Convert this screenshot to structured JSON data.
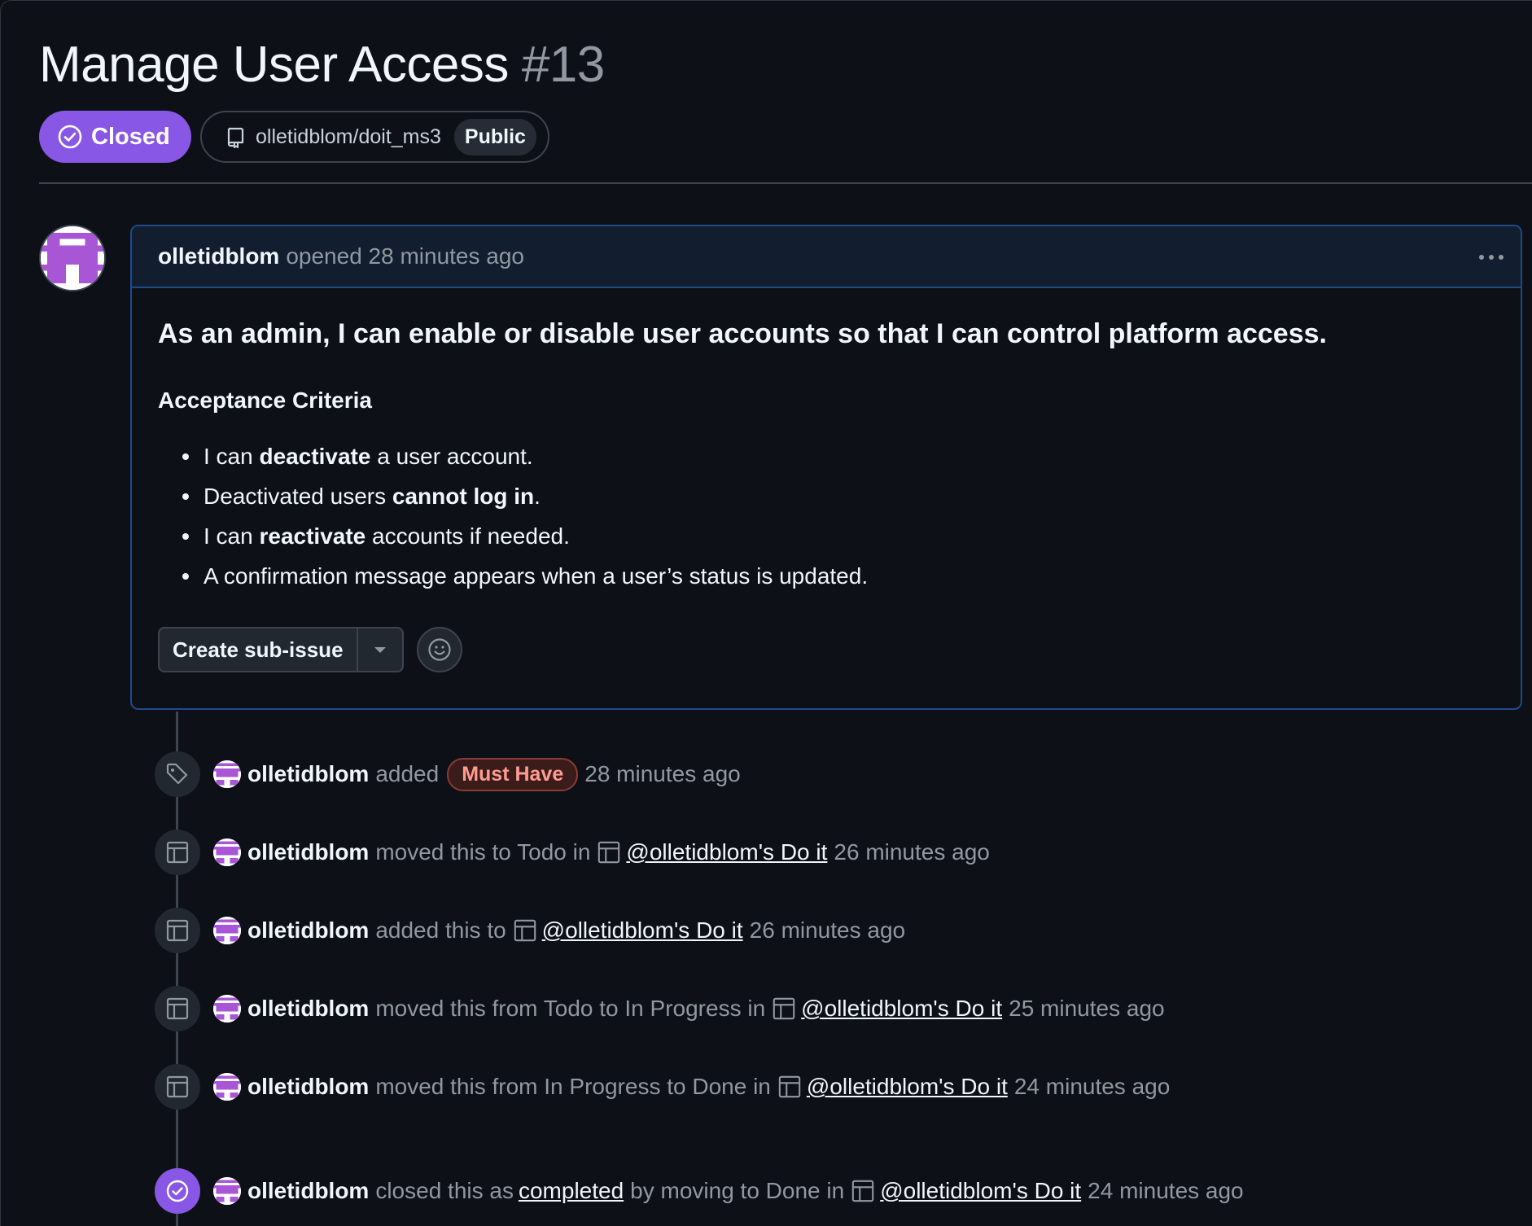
{
  "header": {
    "title": "Manage User Access",
    "number": "#13",
    "state_label": "Closed",
    "repo": "olletidblom/doit_ms3",
    "visibility": "Public"
  },
  "comment": {
    "author": "olletidblom",
    "meta": "opened 28 minutes ago",
    "lead": "As an admin, I can enable or disable user accounts so that I can control platform access.",
    "ac_heading": "Acceptance Criteria",
    "criteria": [
      {
        "pre": "I can ",
        "bold": "deactivate",
        "post": " a user account."
      },
      {
        "pre": "Deactivated users ",
        "bold": "cannot log in",
        "post": "."
      },
      {
        "pre": "I can ",
        "bold": "reactivate",
        "post": " accounts if needed."
      },
      {
        "pre": "A confirmation message appears when a user’s status is updated.",
        "bold": "",
        "post": ""
      }
    ],
    "create_sub_issue_label": "Create sub-issue"
  },
  "timeline": [
    {
      "icon": "tag-icon",
      "actor": "olletidblom",
      "text": "added",
      "label": "Must Have",
      "time": "28 minutes ago"
    },
    {
      "icon": "table-icon",
      "actor": "olletidblom",
      "text": "moved this to Todo in",
      "project": "@olletidblom's Do it",
      "time": "26 minutes ago"
    },
    {
      "icon": "table-icon",
      "actor": "olletidblom",
      "text": "added this to",
      "project": "@olletidblom's Do it",
      "time": "26 minutes ago"
    },
    {
      "icon": "table-icon",
      "actor": "olletidblom",
      "text": "moved this from Todo to In Progress in",
      "project": "@olletidblom's Do it",
      "time": "25 minutes ago"
    },
    {
      "icon": "table-icon",
      "actor": "olletidblom",
      "text": "moved this from In Progress to Done in",
      "project": "@olletidblom's Do it",
      "time": "24 minutes ago"
    },
    {
      "icon": "check-circle-icon",
      "actor": "olletidblom",
      "text": "closed this as",
      "link": "completed",
      "text2": "by moving to Done in",
      "project": "@olletidblom's Do it",
      "time": "24 minutes ago"
    }
  ],
  "colors": {
    "background": "#0d1117",
    "closed_purple": "#8957e5",
    "accent_border": "#1f4a8a",
    "label_red": "#ff9b8f"
  }
}
